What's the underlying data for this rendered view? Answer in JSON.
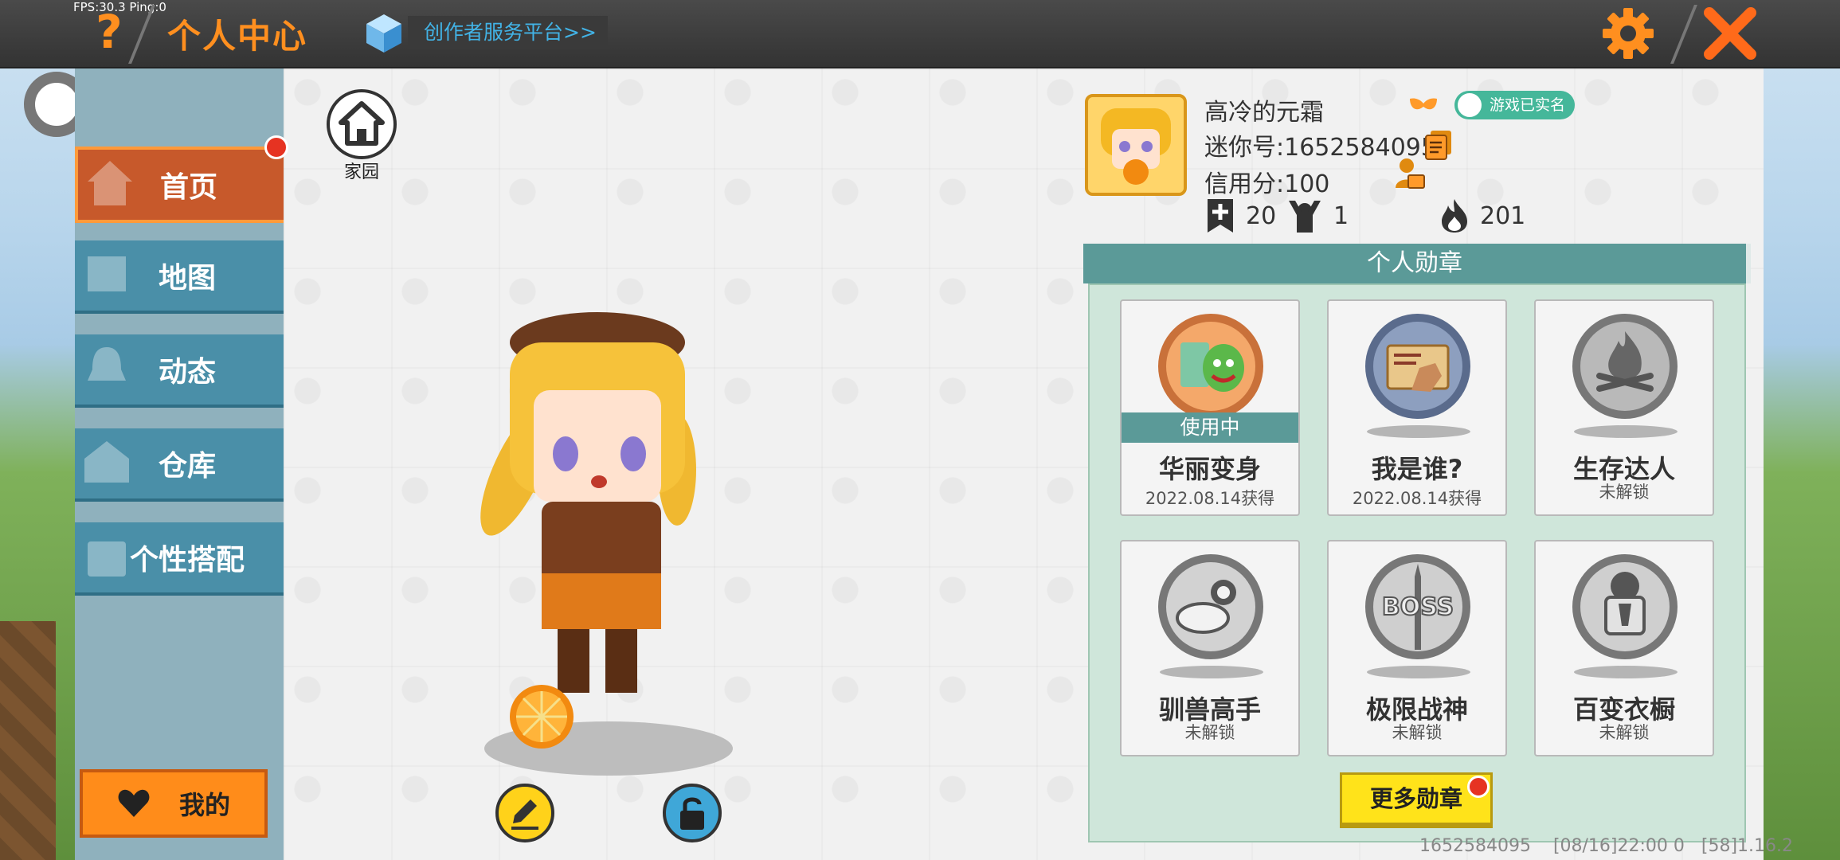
{
  "debug": {
    "fps_text": "FPS:30.3  Ping:0"
  },
  "header": {
    "title": "个人中心",
    "creator_link": "创作者服务平台>>"
  },
  "sidebar": {
    "items": [
      {
        "label": "首页",
        "active": true
      },
      {
        "label": "地图"
      },
      {
        "label": "动态"
      },
      {
        "label": "仓库"
      },
      {
        "label": "个性搭配"
      }
    ],
    "mine_label": "我的"
  },
  "home": {
    "label": "家园"
  },
  "profile": {
    "name": "高冷的元霜",
    "mini_id": "迷你号:1652584095",
    "credit": "信用分:100",
    "verified": "游戏已实名",
    "stats": {
      "follow": "20",
      "fans": "1",
      "hot": "201"
    }
  },
  "medals": {
    "header": "个人勋章",
    "items": [
      {
        "name": "华丽变身",
        "status": "2022.08.14获得",
        "in_use": "使用中"
      },
      {
        "name": "我是谁?",
        "status": "2022.08.14获得"
      },
      {
        "name": "生存达人",
        "status": "未解锁"
      },
      {
        "name": "驯兽高手",
        "status": "未解锁"
      },
      {
        "name": "极限战神",
        "status": "未解锁"
      },
      {
        "name": "百变衣橱",
        "status": "未解锁"
      }
    ],
    "more_label": "更多勋章"
  },
  "footer": {
    "text": "1652584095    [08/16]22:00 0   [58]1.16.2"
  },
  "colors": {
    "accent": "#ff8f1f",
    "teal": "#5b9a98",
    "nav_blue": "#4a8fa8"
  }
}
